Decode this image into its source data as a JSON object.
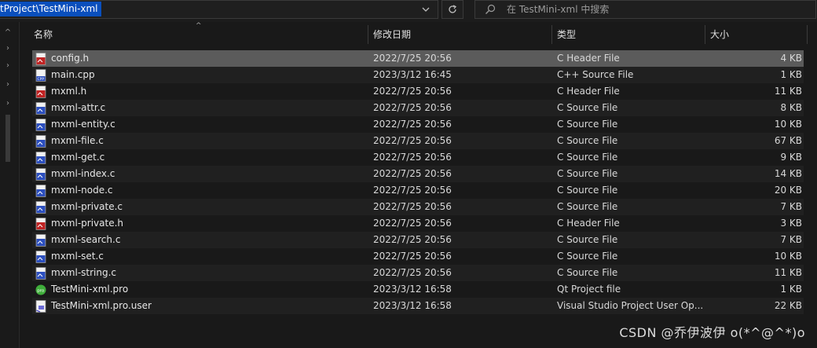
{
  "address": {
    "path_text": "tProject\\TestMini-xml"
  },
  "search": {
    "placeholder": "在 TestMini-xml 中搜索"
  },
  "columns": {
    "name": "名称",
    "date": "修改日期",
    "type": "类型",
    "size": "大小"
  },
  "files": [
    {
      "name": "config.h",
      "date": "2022/7/25 20:56",
      "type": "C Header File",
      "size": "4 KB",
      "icon": "c-header-file-icon"
    },
    {
      "name": "main.cpp",
      "date": "2023/3/12 16:45",
      "type": "C++ Source File",
      "size": "1 KB",
      "icon": "cpp-source-file-icon"
    },
    {
      "name": "mxml.h",
      "date": "2022/7/25 20:56",
      "type": "C Header File",
      "size": "11 KB",
      "icon": "c-header-file-icon"
    },
    {
      "name": "mxml-attr.c",
      "date": "2022/7/25 20:56",
      "type": "C Source File",
      "size": "8 KB",
      "icon": "c-source-file-icon"
    },
    {
      "name": "mxml-entity.c",
      "date": "2022/7/25 20:56",
      "type": "C Source File",
      "size": "10 KB",
      "icon": "c-source-file-icon"
    },
    {
      "name": "mxml-file.c",
      "date": "2022/7/25 20:56",
      "type": "C Source File",
      "size": "67 KB",
      "icon": "c-source-file-icon"
    },
    {
      "name": "mxml-get.c",
      "date": "2022/7/25 20:56",
      "type": "C Source File",
      "size": "9 KB",
      "icon": "c-source-file-icon"
    },
    {
      "name": "mxml-index.c",
      "date": "2022/7/25 20:56",
      "type": "C Source File",
      "size": "14 KB",
      "icon": "c-source-file-icon"
    },
    {
      "name": "mxml-node.c",
      "date": "2022/7/25 20:56",
      "type": "C Source File",
      "size": "20 KB",
      "icon": "c-source-file-icon"
    },
    {
      "name": "mxml-private.c",
      "date": "2022/7/25 20:56",
      "type": "C Source File",
      "size": "7 KB",
      "icon": "c-source-file-icon"
    },
    {
      "name": "mxml-private.h",
      "date": "2022/7/25 20:56",
      "type": "C Header File",
      "size": "3 KB",
      "icon": "c-header-file-icon"
    },
    {
      "name": "mxml-search.c",
      "date": "2022/7/25 20:56",
      "type": "C Source File",
      "size": "7 KB",
      "icon": "c-source-file-icon"
    },
    {
      "name": "mxml-set.c",
      "date": "2022/7/25 20:56",
      "type": "C Source File",
      "size": "10 KB",
      "icon": "c-source-file-icon"
    },
    {
      "name": "mxml-string.c",
      "date": "2022/7/25 20:56",
      "type": "C Source File",
      "size": "11 KB",
      "icon": "c-source-file-icon"
    },
    {
      "name": "TestMini-xml.pro",
      "date": "2023/3/12 16:58",
      "type": "Qt Project file",
      "size": "1 KB",
      "icon": "qt-project-file-icon"
    },
    {
      "name": "TestMini-xml.pro.user",
      "date": "2023/3/12 16:58",
      "type": "Visual Studio Project User Op...",
      "size": "22 KB",
      "icon": "vs-project-user-file-icon"
    }
  ],
  "watermark": "CSDN @乔伊波伊 o(*^@^*)o",
  "colors": {
    "selection": "#0a4fbd",
    "row_selected": "#5b5b5b",
    "background": "#191919"
  }
}
